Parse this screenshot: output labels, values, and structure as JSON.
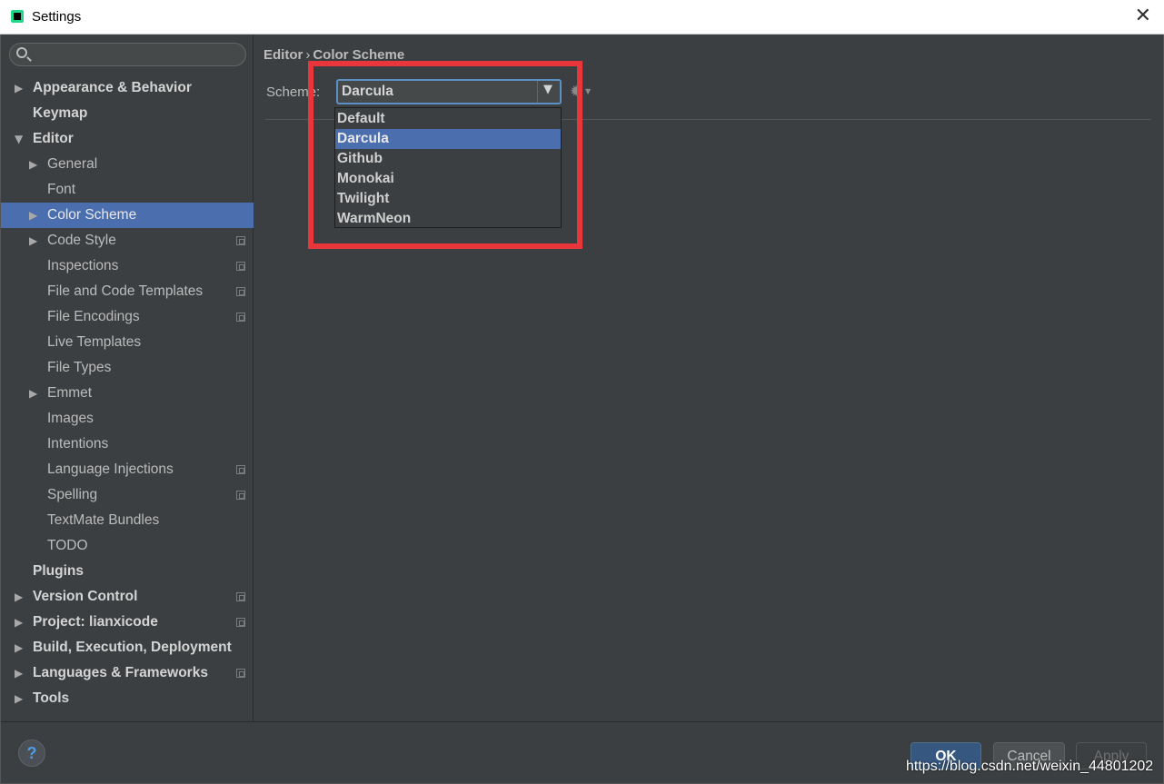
{
  "window": {
    "title": "Settings",
    "close_glyph": "✕"
  },
  "sidebar": {
    "search_placeholder": "",
    "items": [
      {
        "label": "Appearance & Behavior",
        "level": 0,
        "expandable": true,
        "expanded": false,
        "bold": true,
        "copy": false
      },
      {
        "label": "Keymap",
        "level": 0,
        "expandable": false,
        "bold": true,
        "copy": false
      },
      {
        "label": "Editor",
        "level": 0,
        "expandable": true,
        "expanded": true,
        "bold": true,
        "copy": false
      },
      {
        "label": "General",
        "level": 1,
        "expandable": true,
        "expanded": false,
        "copy": false
      },
      {
        "label": "Font",
        "level": 1,
        "expandable": false,
        "copy": false
      },
      {
        "label": "Color Scheme",
        "level": 1,
        "expandable": true,
        "expanded": false,
        "selected": true,
        "copy": false
      },
      {
        "label": "Code Style",
        "level": 1,
        "expandable": true,
        "expanded": false,
        "copy": true
      },
      {
        "label": "Inspections",
        "level": 1,
        "expandable": false,
        "copy": true
      },
      {
        "label": "File and Code Templates",
        "level": 1,
        "expandable": false,
        "copy": true
      },
      {
        "label": "File Encodings",
        "level": 1,
        "expandable": false,
        "copy": true
      },
      {
        "label": "Live Templates",
        "level": 1,
        "expandable": false,
        "copy": false
      },
      {
        "label": "File Types",
        "level": 1,
        "expandable": false,
        "copy": false
      },
      {
        "label": "Emmet",
        "level": 1,
        "expandable": true,
        "expanded": false,
        "copy": false
      },
      {
        "label": "Images",
        "level": 1,
        "expandable": false,
        "copy": false
      },
      {
        "label": "Intentions",
        "level": 1,
        "expandable": false,
        "copy": false
      },
      {
        "label": "Language Injections",
        "level": 1,
        "expandable": false,
        "copy": true
      },
      {
        "label": "Spelling",
        "level": 1,
        "expandable": false,
        "copy": true
      },
      {
        "label": "TextMate Bundles",
        "level": 1,
        "expandable": false,
        "copy": false
      },
      {
        "label": "TODO",
        "level": 1,
        "expandable": false,
        "copy": false
      },
      {
        "label": "Plugins",
        "level": 0,
        "expandable": false,
        "bold": true,
        "copy": false
      },
      {
        "label": "Version Control",
        "level": 0,
        "expandable": true,
        "expanded": false,
        "bold": true,
        "copy": true
      },
      {
        "label": "Project: lianxicode",
        "level": 0,
        "expandable": true,
        "expanded": false,
        "bold": true,
        "copy": true
      },
      {
        "label": "Build, Execution, Deployment",
        "level": 0,
        "expandable": true,
        "expanded": false,
        "bold": true,
        "copy": false
      },
      {
        "label": "Languages & Frameworks",
        "level": 0,
        "expandable": true,
        "expanded": false,
        "bold": true,
        "copy": true
      },
      {
        "label": "Tools",
        "level": 0,
        "expandable": true,
        "expanded": false,
        "bold": true,
        "copy": false
      }
    ]
  },
  "main": {
    "breadcrumb": {
      "parent": "Editor",
      "separator": "›",
      "current": "Color Scheme"
    },
    "scheme_label": "Scheme:",
    "scheme_value": "Darcula",
    "dropdown_options": [
      "Default",
      "Darcula",
      "Github",
      "Monokai",
      "Twilight",
      "WarmNeon"
    ],
    "dropdown_selected": "Darcula"
  },
  "footer": {
    "help_label": "?",
    "ok_label": "OK",
    "cancel_label": "Cancel",
    "apply_label": "Apply",
    "watermark": "https://blog.csdn.net/weixin_44801202"
  },
  "colors": {
    "background": "#3c3f41",
    "selection": "#4b6eaf",
    "highlight_box": "#e8363a",
    "text": "#bbbbbb"
  }
}
